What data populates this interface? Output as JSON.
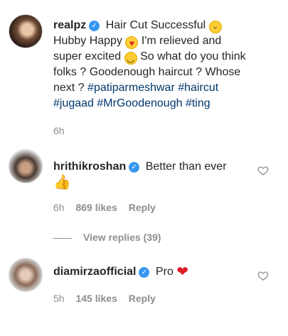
{
  "comments": [
    {
      "username": "realpz",
      "text_parts": [
        "Hair Cut Successful",
        "Hubby Happy",
        "I'm relieved and super excited",
        "So what do you think folks ? Goodenough haircut ? Whose next ?"
      ],
      "hashtags": [
        "#patiparmeshwar",
        "#haircut",
        "#jugaad",
        "#MrGoodenough",
        "#ting"
      ],
      "time": "6h"
    },
    {
      "username": "hrithikroshan",
      "text": "Better than ever",
      "time": "6h",
      "likes": "869 likes",
      "reply_label": "Reply"
    },
    {
      "username": "diamirzaofficial",
      "text": "Pro",
      "time": "5h",
      "likes": "145 likes",
      "reply_label": "Reply"
    }
  ],
  "view_replies_label": "View replies (39)",
  "icons": {
    "verified": "verified-badge-icon",
    "like": "heart-outline-icon"
  },
  "colors": {
    "text": "#262626",
    "muted": "#8e8e8e",
    "hashtag": "#00376b",
    "verified": "#3897f0"
  }
}
